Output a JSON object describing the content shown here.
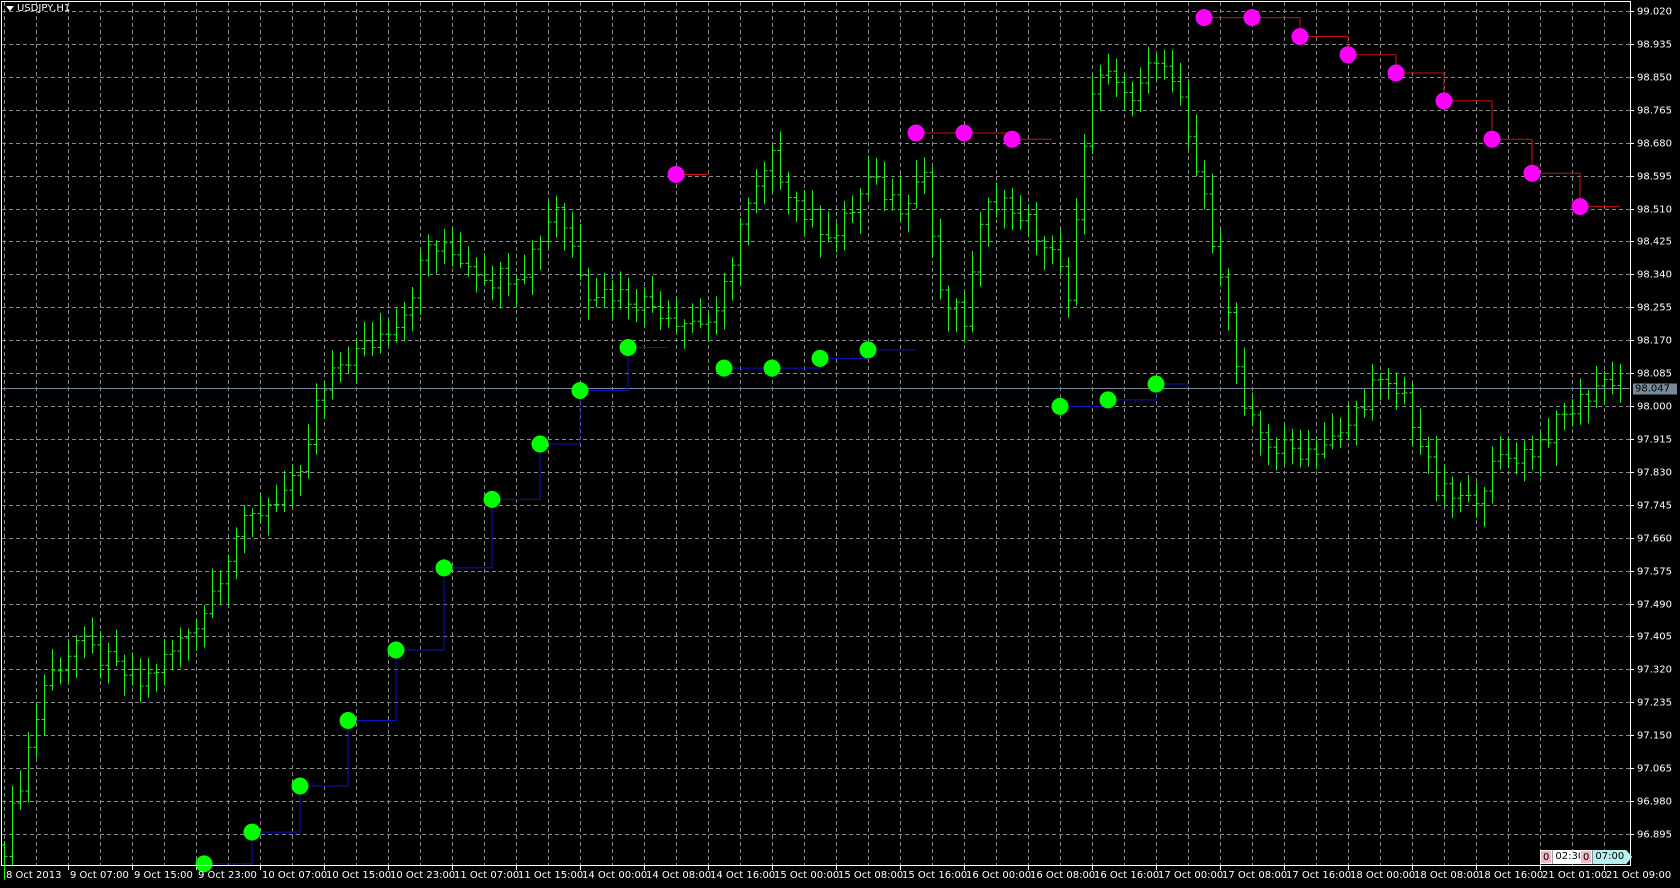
{
  "chart_data": {
    "type": "ohlc-bar",
    "symbol_title": "USDJPY,H1",
    "ylim": [
      96.85,
      99.04
    ],
    "grid": true,
    "colors": {
      "bars": "#22ee22",
      "support_dot": "#00ff00",
      "support_line": "#1010c0",
      "resistance_dot": "#ff00ff",
      "resistance_line": "#cc1010",
      "current_line": "#778899",
      "grid": "#8a8a8a"
    },
    "bar_count": 203,
    "price_ticks": [
      "99.020",
      "98.935",
      "98.850",
      "98.765",
      "98.680",
      "98.595",
      "98.510",
      "98.425",
      "98.340",
      "98.255",
      "98.170",
      "98.085",
      "98.000",
      "97.915",
      "97.830",
      "97.745",
      "97.660",
      "97.575",
      "97.490",
      "97.405",
      "97.320",
      "97.235",
      "97.150",
      "97.065",
      "96.980",
      "96.895"
    ],
    "current_price": "98.047",
    "time_labels": [
      "8 Oct 2013",
      "9 Oct 07:00",
      "9 Oct 15:00",
      "9 Oct 23:00",
      "10 Oct 07:00",
      "10 Oct 15:00",
      "10 Oct 23:00",
      "11 Oct 07:00",
      "11 Oct 15:00",
      "14 Oct 00:00",
      "14 Oct 08:00",
      "14 Oct 16:00",
      "15 Oct 00:00",
      "15 Oct 08:00",
      "15 Oct 16:00",
      "16 Oct 00:00",
      "16 Oct 08:00",
      "16 Oct 16:00",
      "17 Oct 00:00",
      "17 Oct 08:00",
      "17 Oct 16:00",
      "18 Oct 00:00",
      "18 Oct 08:00",
      "18 Oct 16:00",
      "21 Oct 01:00",
      "21 Oct 09:00"
    ],
    "price_path": [
      [
        0,
        96.867
      ],
      [
        5,
        97.281
      ],
      [
        9,
        97.392
      ],
      [
        13,
        97.336
      ],
      [
        17,
        97.281
      ],
      [
        21,
        97.364
      ],
      [
        25,
        97.474
      ],
      [
        29,
        97.668
      ],
      [
        33,
        97.75
      ],
      [
        37,
        97.806
      ],
      [
        39,
        97.999
      ],
      [
        42,
        98.109
      ],
      [
        46,
        98.164
      ],
      [
        50,
        98.247
      ],
      [
        53,
        98.413
      ],
      [
        57,
        98.385
      ],
      [
        61,
        98.33
      ],
      [
        65,
        98.358
      ],
      [
        69,
        98.523
      ],
      [
        73,
        98.302
      ],
      [
        77,
        98.289
      ],
      [
        81,
        98.261
      ],
      [
        85,
        98.22
      ],
      [
        89,
        98.22
      ],
      [
        92,
        98.468
      ],
      [
        96,
        98.634
      ],
      [
        100,
        98.496
      ],
      [
        104,
        98.44
      ],
      [
        108,
        98.578
      ],
      [
        112,
        98.523
      ],
      [
        115,
        98.606
      ],
      [
        117,
        98.275
      ],
      [
        120,
        98.22
      ],
      [
        123,
        98.551
      ],
      [
        127,
        98.496
      ],
      [
        131,
        98.385
      ],
      [
        133,
        98.302
      ],
      [
        136,
        98.827
      ],
      [
        139,
        98.854
      ],
      [
        141,
        98.772
      ],
      [
        144,
        98.91
      ],
      [
        147,
        98.772
      ],
      [
        149,
        98.606
      ],
      [
        152,
        98.358
      ],
      [
        155,
        97.971
      ],
      [
        159,
        97.888
      ],
      [
        163,
        97.888
      ],
      [
        167,
        97.916
      ],
      [
        171,
        98.054
      ],
      [
        175,
        98.026
      ],
      [
        179,
        97.778
      ],
      [
        183,
        97.75
      ],
      [
        187,
        97.861
      ],
      [
        191,
        97.888
      ],
      [
        195,
        97.971
      ],
      [
        199,
        98.054
      ],
      [
        202,
        98.082
      ]
    ],
    "support_groups": [
      {
        "end_bar": 83,
        "dots": [
          [
            25,
            96.818
          ],
          [
            31,
            96.9
          ],
          [
            37,
            97.019
          ],
          [
            43,
            97.188
          ],
          [
            49,
            97.37
          ],
          [
            55,
            97.582
          ],
          [
            61,
            97.759
          ],
          [
            67,
            97.902
          ],
          [
            72,
            98.04
          ],
          [
            78,
            98.151
          ]
        ]
      },
      {
        "end_bar": 114,
        "dots": [
          [
            90,
            98.098
          ],
          [
            96,
            98.098
          ],
          [
            102,
            98.123
          ],
          [
            108,
            98.145
          ]
        ]
      },
      {
        "end_bar": 148,
        "dots": [
          [
            132,
            97.999
          ],
          [
            138,
            98.016
          ],
          [
            144,
            98.057
          ]
        ]
      }
    ],
    "resistance_groups": [
      {
        "end_bar": 88,
        "dots": [
          [
            84,
            98.598
          ]
        ]
      },
      {
        "end_bar": 131,
        "dots": [
          [
            114,
            98.705
          ],
          [
            120,
            98.705
          ],
          [
            126,
            98.689
          ]
        ]
      },
      {
        "end_bar": 202,
        "dots": [
          [
            150,
            99.003
          ],
          [
            156,
            99.003
          ],
          [
            162,
            98.954
          ],
          [
            168,
            98.907
          ],
          [
            174,
            98.86
          ],
          [
            180,
            98.788
          ],
          [
            186,
            98.689
          ],
          [
            191,
            98.601
          ],
          [
            197,
            98.515
          ]
        ]
      }
    ],
    "timers": [
      {
        "count": "0",
        "time": "02:30",
        "color": "#ffffff"
      },
      {
        "count": "0",
        "time": "07:00",
        "color": "#b8f0f0"
      }
    ]
  }
}
